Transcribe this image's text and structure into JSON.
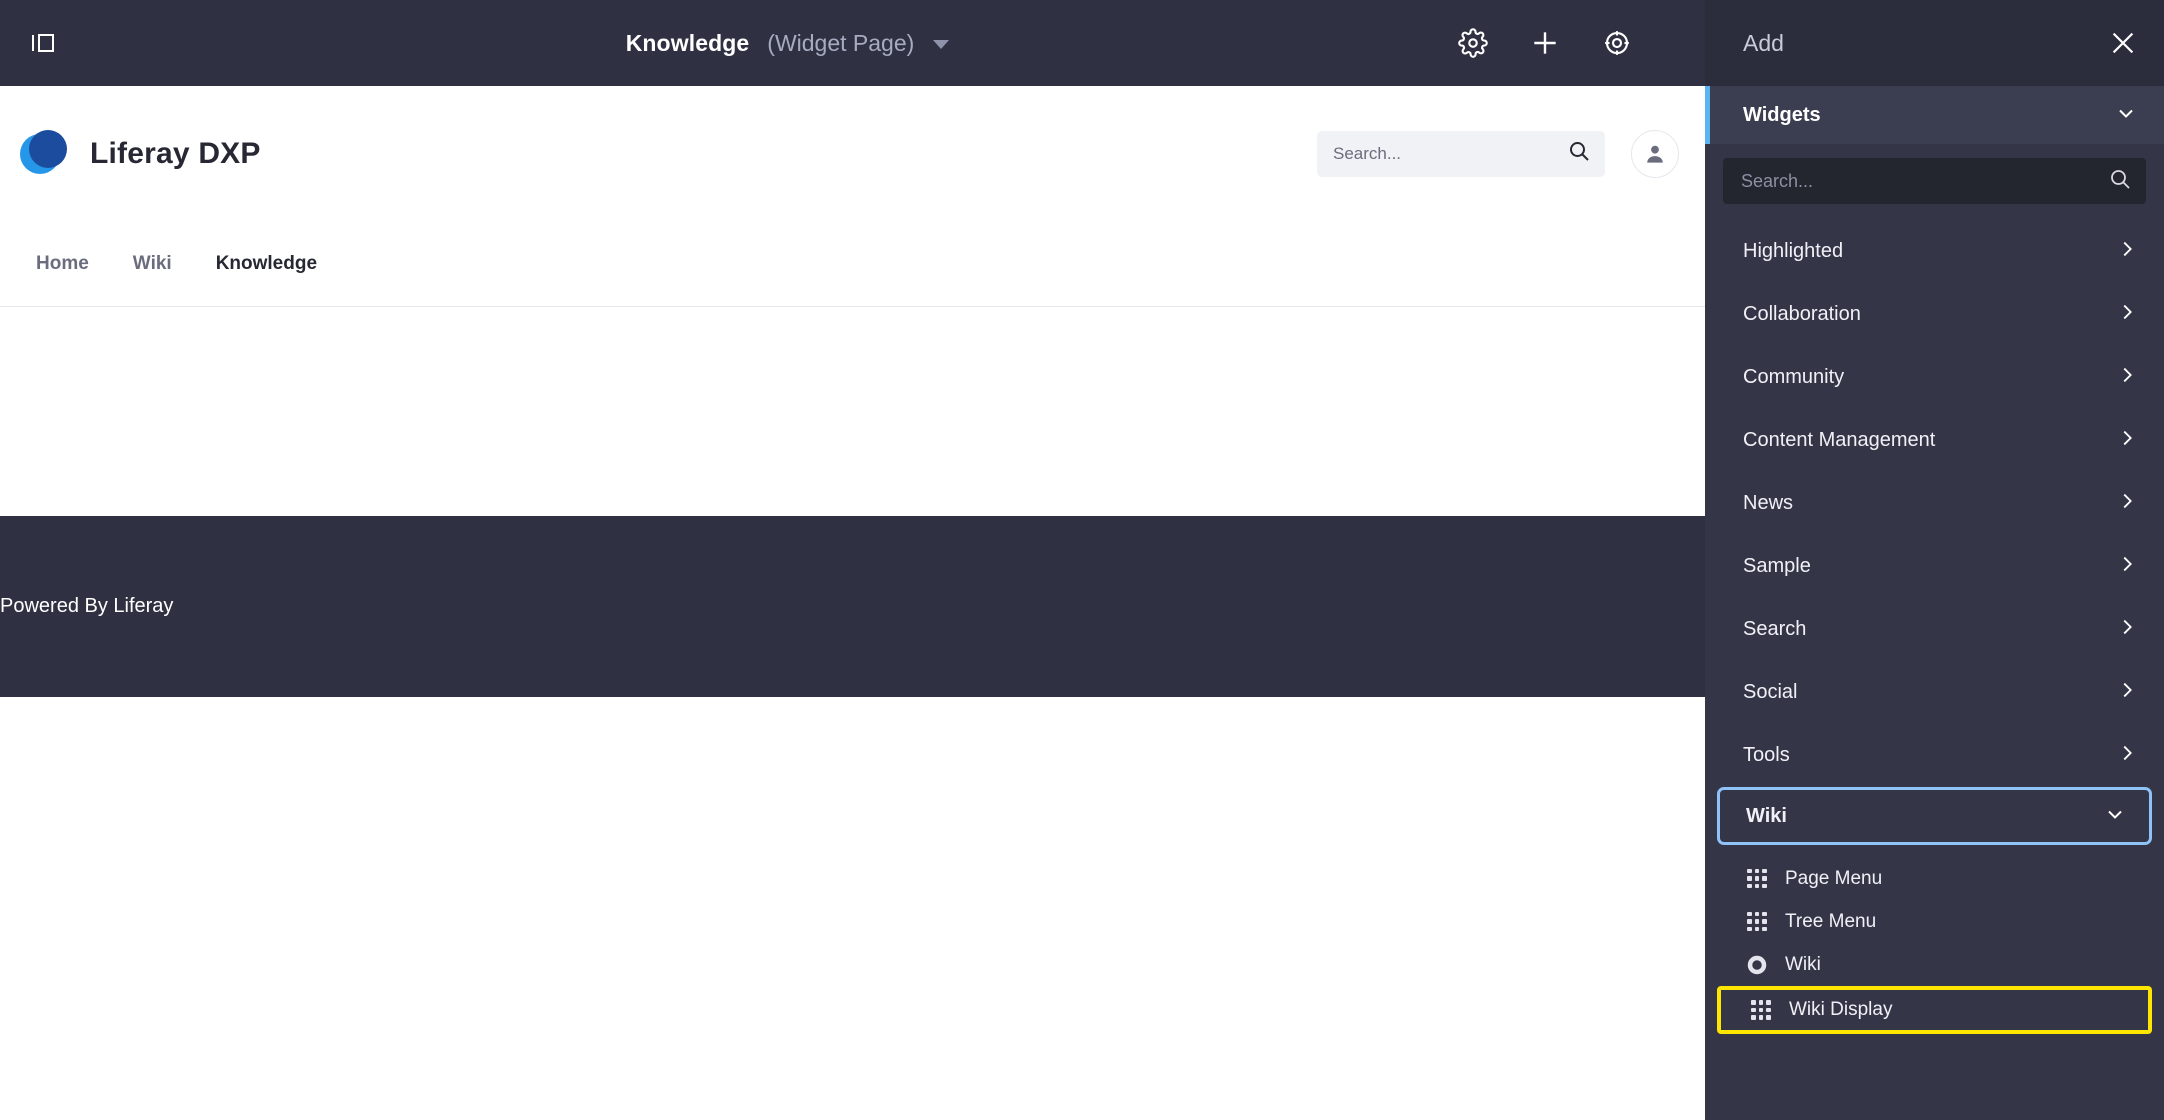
{
  "topbar": {
    "panel_toggle_icon": "sidebar-toggle-icon",
    "page_title": "Knowledge",
    "page_type": "(Widget Page)",
    "dropdown_icon": "caret-down-icon",
    "icons": [
      {
        "name": "gear-icon",
        "label": "Settings"
      },
      {
        "name": "plus-icon",
        "label": "Add"
      },
      {
        "name": "target-icon",
        "label": "Preview"
      }
    ]
  },
  "site": {
    "brand_name": "Liferay DXP",
    "logo_colors": {
      "light": "#2596e8",
      "dark": "#1b4c9e"
    },
    "search": {
      "placeholder": "Search...",
      "value": "",
      "icon": "search-icon"
    },
    "avatar_icon": "user-icon",
    "nav": [
      {
        "label": "Home",
        "active": false
      },
      {
        "label": "Wiki",
        "active": false
      },
      {
        "label": "Knowledge",
        "active": true
      }
    ],
    "footer_text": "Powered By Liferay"
  },
  "add_panel": {
    "title": "Add",
    "close_icon": "close-icon",
    "widgets_section": {
      "label": "Widgets",
      "expanded": true,
      "chevron_icon": "chevron-down-icon",
      "accent_color": "#5cb3f2"
    },
    "search": {
      "placeholder": "Search...",
      "value": "",
      "icon": "search-icon"
    },
    "categories": [
      {
        "label": "Highlighted",
        "chevron": "chevron-right-icon"
      },
      {
        "label": "Collaboration",
        "chevron": "chevron-right-icon"
      },
      {
        "label": "Community",
        "chevron": "chevron-right-icon"
      },
      {
        "label": "Content Management",
        "chevron": "chevron-right-icon"
      },
      {
        "label": "News",
        "chevron": "chevron-right-icon"
      },
      {
        "label": "Sample",
        "chevron": "chevron-right-icon"
      },
      {
        "label": "Search",
        "chevron": "chevron-right-icon"
      },
      {
        "label": "Social",
        "chevron": "chevron-right-icon"
      },
      {
        "label": "Tools",
        "chevron": "chevron-right-icon"
      }
    ],
    "wiki_section": {
      "label": "Wiki",
      "expanded": true,
      "chevron_icon": "chevron-down-icon",
      "focus_outline_color": "#8fc2f7"
    },
    "wiki_widgets": [
      {
        "label": "Page Menu",
        "icon": "grid-icon",
        "highlighted": false
      },
      {
        "label": "Tree Menu",
        "icon": "grid-icon",
        "highlighted": false
      },
      {
        "label": "Wiki",
        "icon": "ring-icon",
        "highlighted": false
      },
      {
        "label": "Wiki Display",
        "icon": "grid-icon",
        "highlighted": true
      }
    ],
    "highlight_color": "#ffe600"
  }
}
